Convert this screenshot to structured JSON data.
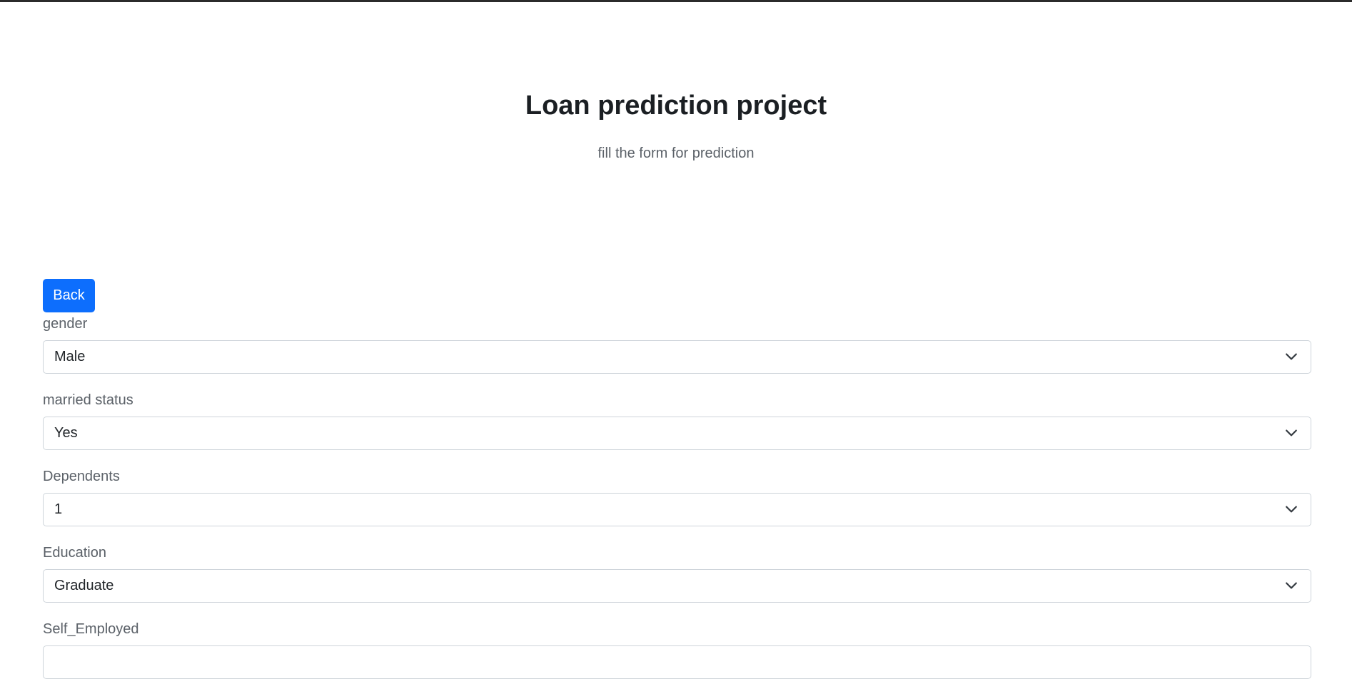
{
  "header": {
    "title": "Loan prediction project",
    "subtitle": "fill the form for prediction"
  },
  "back_button": {
    "label": "Back",
    "color": "#0d6efd"
  },
  "form": {
    "fields": [
      {
        "label": "gender",
        "value": "Male"
      },
      {
        "label": "married status",
        "value": "Yes"
      },
      {
        "label": "Dependents",
        "value": "1"
      },
      {
        "label": "Education",
        "value": "Graduate"
      },
      {
        "label": "Self_Employed",
        "value": ""
      }
    ]
  },
  "icons": {
    "select_chevron": "chevron-down-icon"
  }
}
